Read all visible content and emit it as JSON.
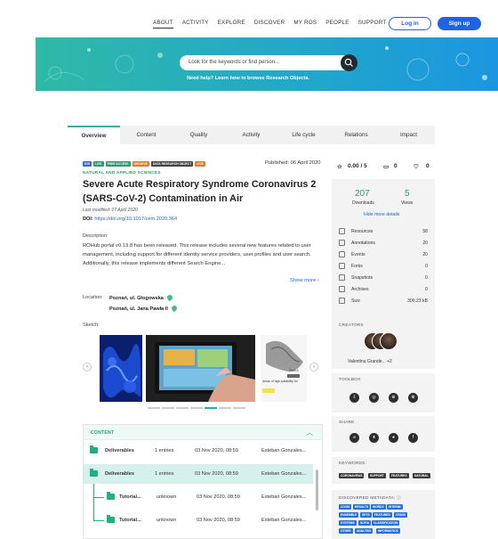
{
  "nav": {
    "links": [
      "ABOUT",
      "ACTIVITY",
      "EXPLORE",
      "DISCOVER",
      "MY ROS",
      "PEOPLE",
      "SUPPORT"
    ],
    "login": "Log in",
    "signup": "Sign up"
  },
  "search": {
    "placeholder": "Look for the keywords or find person...",
    "help": "Need help? Learn how to browse Research Objects."
  },
  "tabs": [
    "Overview",
    "Content",
    "Quality",
    "Activity",
    "Life cycle",
    "Relations",
    "Impact"
  ],
  "ro": {
    "badges": [
      {
        "text": "DOI",
        "color": "#2d6fd0"
      },
      {
        "text": "LIVE",
        "color": "#2a9d6e"
      },
      {
        "text": "FREE ACCESS",
        "color": "#2a9d6e"
      },
      {
        "text": "ARCHIVE",
        "color": "#e07b2a"
      },
      {
        "text": "DATA RESEARCH OBJECT",
        "color": "#444444"
      },
      {
        "text": "LIVE",
        "color": "#e07b2a"
      }
    ],
    "published": "Published: 06 April 2020",
    "category": "NATURAL AND APPLIED SCIENCES",
    "title": "Severe Acute Respiratory Syndrome Coronavirus 2 (SARS-CoV-2) Contamination in Air",
    "modified": "Last modified: 07 April 2020",
    "doi_label": "DOI:",
    "doi_value": "https://doi.org/10.1017/cem.2020.364",
    "desc_label": "Description:",
    "description": "ROHub portal v0.13.8 has been released. This release includes several new features related to user management, including support for different identity service providers, user profiles and user search. Additionally, this release implements different Search Engine...",
    "show_more": "Show more ›",
    "location_label": "Location:",
    "location_1": "Poznań, ul. Głogowska",
    "location_2": "Poznań, ul. Jana Pawła II",
    "sketch_label": "Sketch:",
    "sketch_caption": "Areas of high suitability for",
    "sketch_tag": "Zone A"
  },
  "content": {
    "header": "CONTENT",
    "rows": [
      {
        "name": "Deliverables",
        "count": "1 entries",
        "date": "03 Nov 2020, 08:59",
        "author": "Esteban Gonzales..."
      },
      {
        "name": "Deliverables",
        "count": "1 entries",
        "date": "03 Nov 2020, 08:59",
        "author": "Esteban Gonzales..."
      },
      {
        "name": "Tutorial...",
        "count": "unknown",
        "date": "03 Nov 2020, 08:59",
        "author": "Esteban Gonzales..."
      },
      {
        "name": "Tutorial...",
        "count": "unknown",
        "date": "03 Nov 2020, 08:59",
        "author": "Esteban Gonzales..."
      }
    ]
  },
  "rating": {
    "score": "0.00 / 5",
    "comments": "0",
    "likes": "0"
  },
  "stats": {
    "downloads": "207",
    "downloads_label": "Downloads",
    "views": "5",
    "views_label": "Views",
    "hide": "Hide more details",
    "details": [
      {
        "label": "Resources",
        "value": "58"
      },
      {
        "label": "Annotations",
        "value": "20"
      },
      {
        "label": "Events",
        "value": "20"
      },
      {
        "label": "Forks",
        "value": "0"
      },
      {
        "label": "Snapshots",
        "value": "0"
      },
      {
        "label": "Archives",
        "value": "0"
      },
      {
        "label": "Size",
        "value": "300.23 kB"
      }
    ]
  },
  "creators": {
    "header": "CREATORS",
    "names": "Valentina Grande... +2"
  },
  "toolbox": {
    "header": "TOOLBOX"
  },
  "share": {
    "header": "SHARE"
  },
  "keywords": {
    "header": "KEYWORDS:",
    "items": [
      "CORONAVIRUS",
      "SUPPORT",
      "FEATURES",
      "NATURAL"
    ]
  },
  "discovered": {
    "header": "DISCOVERED METADATA: ⓘ",
    "items": [
      "COVID",
      "RESULTS",
      "WORDS",
      "INTERIM",
      "ENSEMBLE",
      "SETS",
      "FEATURED",
      "CRISIS",
      "SYSTEMS",
      "SOFIA",
      "CLASSIFICATION",
      "OTHER",
      "ANALYSIS",
      "INFORMATICS"
    ]
  }
}
